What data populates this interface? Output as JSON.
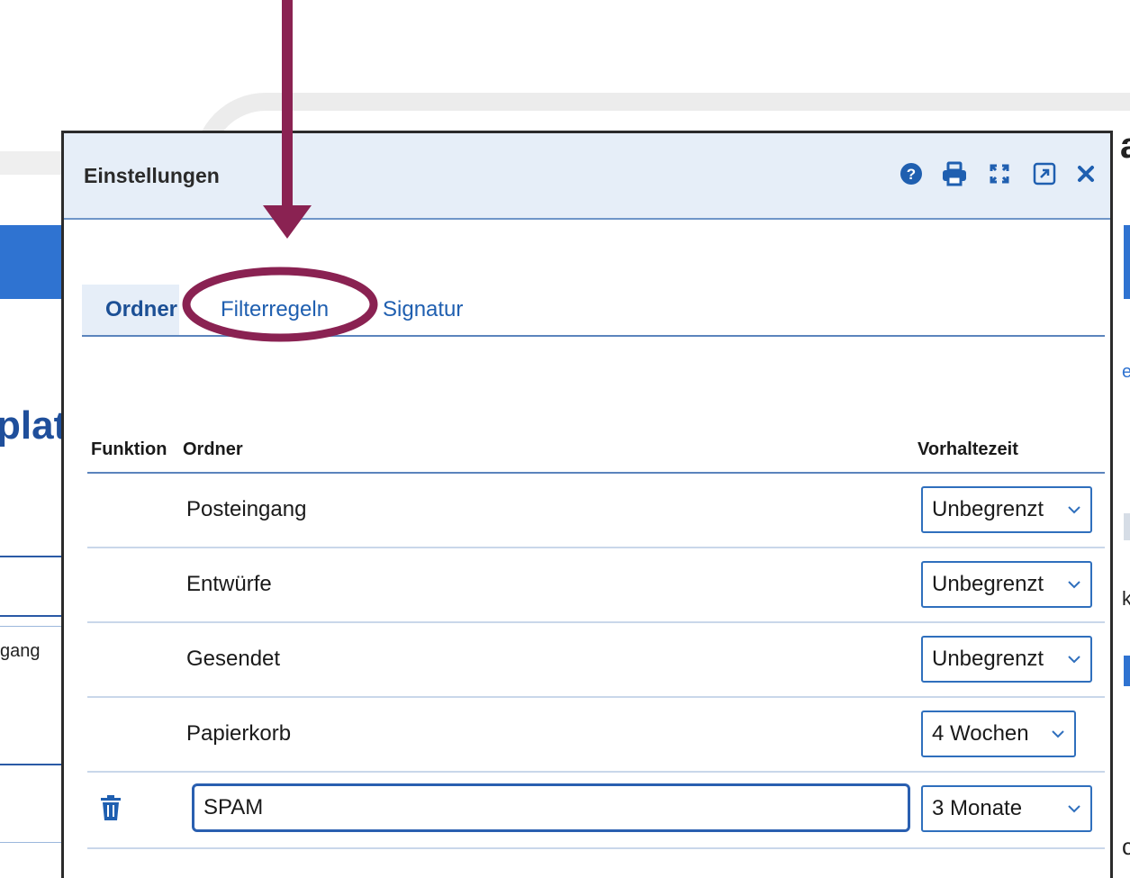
{
  "background": {
    "heading_fragment": "plat",
    "list_fragment": "gang",
    "right_char": "a",
    "right_e": "e",
    "right_k": "k",
    "right_c": "c"
  },
  "dialog": {
    "title": "Einstellungen",
    "header_icons": [
      "help-icon",
      "print-icon",
      "fullscreen-icon",
      "popout-icon",
      "close-icon"
    ],
    "tabs": [
      {
        "label": "Ordner",
        "active": true
      },
      {
        "label": "Filterregeln",
        "active": false
      },
      {
        "label": "Signatur",
        "active": false
      }
    ],
    "columns": {
      "function": "Funktion",
      "folder": "Ordner",
      "retention": "Vorhaltezeit"
    },
    "rows": [
      {
        "folder": "Posteingang",
        "retention": "Unbegrenzt"
      },
      {
        "folder": "Entwürfe",
        "retention": "Unbegrenzt"
      },
      {
        "folder": "Gesendet",
        "retention": "Unbegrenzt"
      },
      {
        "folder": "Papierkorb",
        "retention": "4 Wochen"
      },
      {
        "folder": "SPAM",
        "retention": "3 Monate",
        "editable": true,
        "function_icon": "trash-icon"
      }
    ]
  },
  "annotation": {
    "color": "#8a2252",
    "highlighted_tab": "Filterregeln"
  }
}
